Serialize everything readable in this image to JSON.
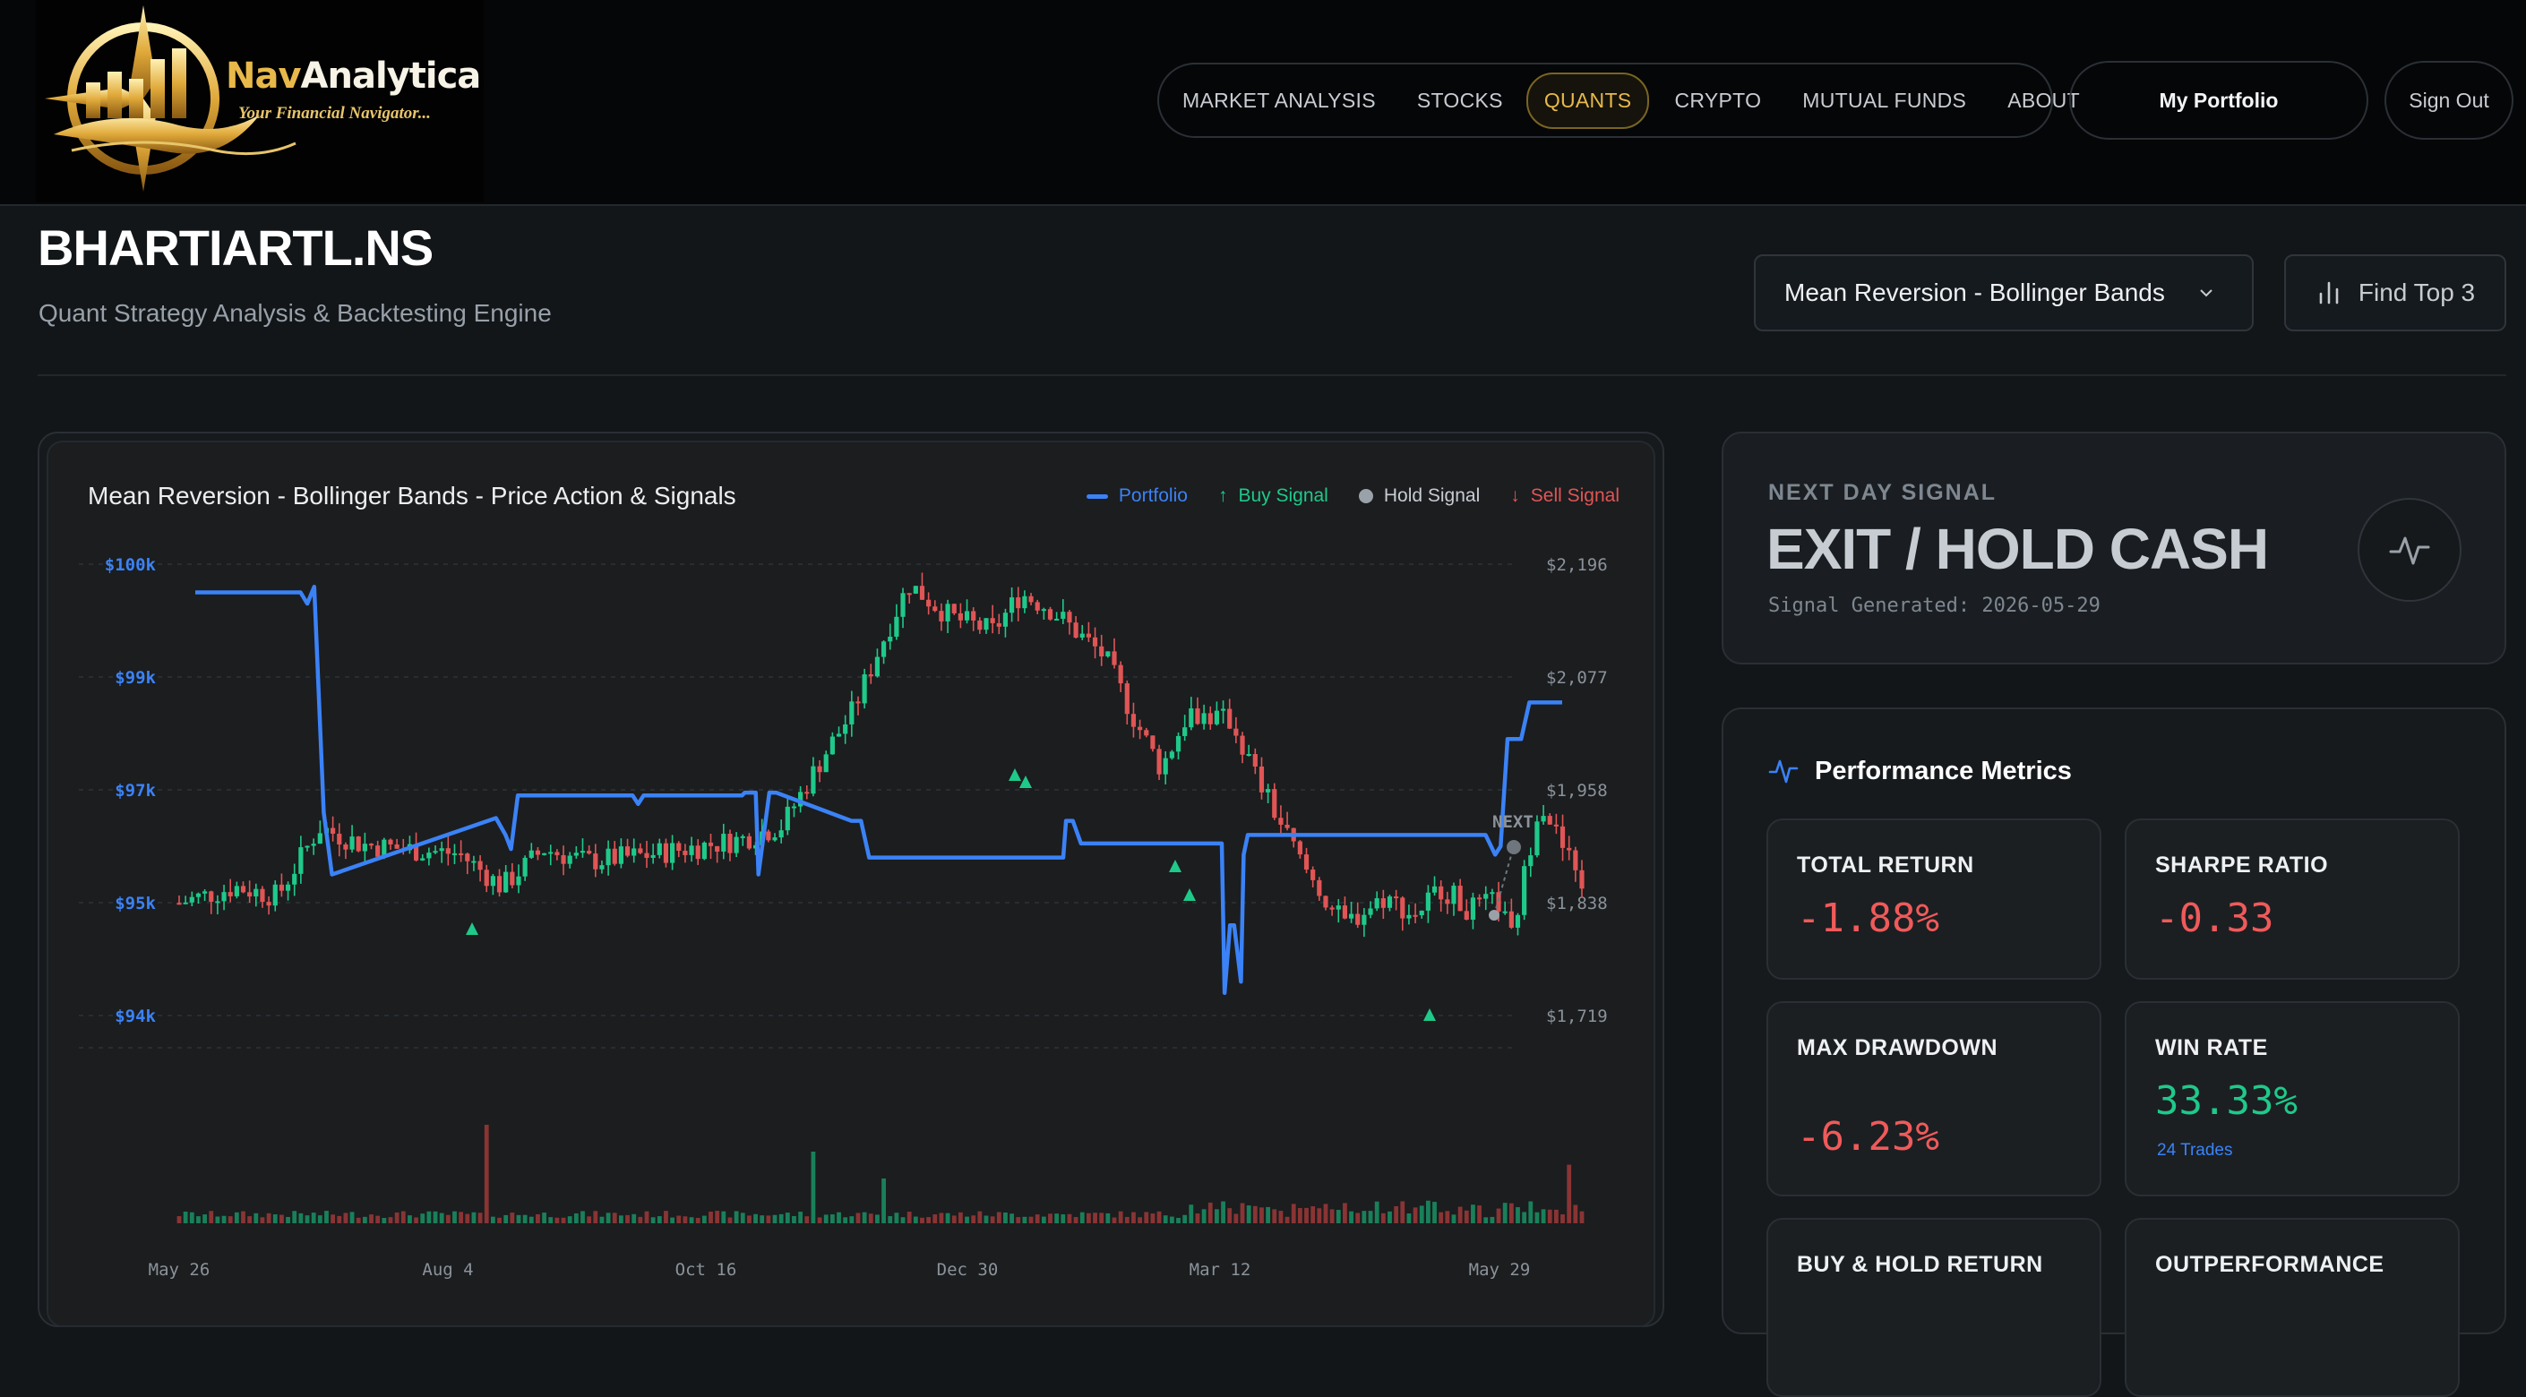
{
  "brand": {
    "name_part1": "Nav",
    "name_part2": "Analytica",
    "tagline": "Your Financial Navigator..."
  },
  "nav": {
    "items": [
      {
        "label": "MARKET ANALYSIS"
      },
      {
        "label": "STOCKS"
      },
      {
        "label": "QUANTS",
        "active": true
      },
      {
        "label": "CRYPTO"
      },
      {
        "label": "MUTUAL FUNDS"
      },
      {
        "label": "ABOUT"
      }
    ],
    "portfolio_label": "My Portfolio",
    "signout_label": "Sign Out"
  },
  "page": {
    "ticker": "BHARTIARTL.NS",
    "subtitle": "Quant Strategy Analysis & Backtesting Engine",
    "strategy_selected": "Mean Reversion - Bollinger Bands",
    "find_top_label": "Find Top 3"
  },
  "chart": {
    "title": "Mean Reversion - Bollinger Bands - Price Action & Signals",
    "legend": {
      "portfolio": "Portfolio",
      "buy": "Buy Signal",
      "hold": "Hold Signal",
      "sell": "Sell Signal"
    },
    "next_label": "NEXT"
  },
  "chart_data": {
    "type": "line",
    "title": "Mean Reversion - Bollinger Bands - Price Action & Signals",
    "x_ticks": [
      "May 26",
      "Aug 4",
      "Oct 16",
      "Dec 30",
      "Mar 12",
      "May 29"
    ],
    "y_left_ticks": [
      "$100k",
      "$99k",
      "$97k",
      "$95k",
      "$94k"
    ],
    "y_right_ticks": [
      "$2,196",
      "$2,077",
      "$1,958",
      "$1,838",
      "$1,719"
    ],
    "y_left_range": [
      93500,
      100500
    ],
    "y_right_range": [
      1719,
      2196
    ],
    "portfolio_series": {
      "name": "Portfolio",
      "x": [
        0,
        0.077,
        0.082,
        0.087,
        0.094,
        0.1,
        0.22,
        0.227,
        0.231,
        0.236,
        0.32,
        0.324,
        0.328,
        0.4,
        0.402,
        0.41,
        0.412,
        0.42,
        0.425,
        0.48,
        0.487,
        0.493,
        0.635,
        0.637,
        0.642,
        0.648,
        0.751,
        0.753,
        0.757,
        0.76,
        0.765,
        0.767,
        0.77,
        0.944,
        0.951,
        0.955,
        0.96,
        0.97,
        0.976,
        0.982,
        1.0
      ],
      "y": [
        99750,
        99750,
        99650,
        99800,
        96600,
        95500,
        96500,
        96200,
        95950,
        96900,
        96900,
        96750,
        96900,
        96900,
        96950,
        96950,
        95500,
        96950,
        96950,
        96450,
        96450,
        95800,
        95800,
        96450,
        96450,
        96050,
        96050,
        94200,
        94800,
        94800,
        94300,
        95850,
        96200,
        96200,
        95850,
        96000,
        97900,
        97900,
        98550,
        98550,
        98550
      ]
    },
    "price_series": {
      "name": "Price",
      "anchor_x": [
        0,
        0.04,
        0.07,
        0.1,
        0.13,
        0.16,
        0.2,
        0.23,
        0.26,
        0.29,
        0.33,
        0.36,
        0.4,
        0.43,
        0.46,
        0.48,
        0.5,
        0.52,
        0.55,
        0.58,
        0.6,
        0.62,
        0.66,
        0.68,
        0.7,
        0.72,
        0.75,
        0.77,
        0.8,
        0.83,
        0.86,
        0.88,
        0.9,
        0.92,
        0.94,
        0.95,
        0.97,
        0.985,
        1.0
      ],
      "anchor_y": [
        1838,
        1855,
        1845,
        1918,
        1900,
        1895,
        1890,
        1855,
        1895,
        1882,
        1888,
        1895,
        1905,
        1920,
        1995,
        2040,
        2110,
        2175,
        2140,
        2125,
        2165,
        2150,
        2098,
        2035,
        1980,
        2040,
        2030,
        1965,
        1880,
        1815,
        1845,
        1825,
        1855,
        1830,
        1840,
        1800,
        1950,
        1900,
        1860
      ]
    },
    "signals": [
      {
        "type": "buy",
        "x": "Aug 4"
      },
      {
        "type": "buy",
        "x": "Dec 12"
      },
      {
        "type": "buy",
        "x": "Dec 15"
      },
      {
        "type": "buy",
        "x": "Mar 5"
      },
      {
        "type": "buy",
        "x": "Mar 14"
      },
      {
        "type": "buy",
        "x": "May 14"
      },
      {
        "type": "hold",
        "x": "May 29"
      },
      {
        "type": "hold",
        "x": "NEXT"
      }
    ],
    "colors": {
      "portfolio": "#3b82f6",
      "up": "#1fc98a",
      "down": "#e05555",
      "hold": "#9aa1a9"
    },
    "grid": true,
    "legend_position": "top-right"
  },
  "signal": {
    "label": "NEXT DAY SIGNAL",
    "value": "EXIT / HOLD CASH",
    "generated": "Signal Generated: 2026-05-29"
  },
  "metrics": {
    "title": "Performance Metrics",
    "total_return": {
      "label": "TOTAL RETURN",
      "value": "-1.88%"
    },
    "sharpe": {
      "label": "SHARPE RATIO",
      "value": "-0.33"
    },
    "max_drawdown": {
      "label": "MAX DRAWDOWN",
      "value": "-6.23%"
    },
    "win_rate": {
      "label": "WIN RATE",
      "value": "33.33%",
      "sub": "24 Trades"
    },
    "buy_hold": {
      "label": "BUY & HOLD RETURN"
    },
    "outperformance": {
      "label": "OUTPERFORMANCE"
    }
  },
  "icons": [
    "chevron-down-icon",
    "bar-chart-icon",
    "pulse-icon",
    "arrow-up-icon",
    "arrow-down-icon"
  ]
}
